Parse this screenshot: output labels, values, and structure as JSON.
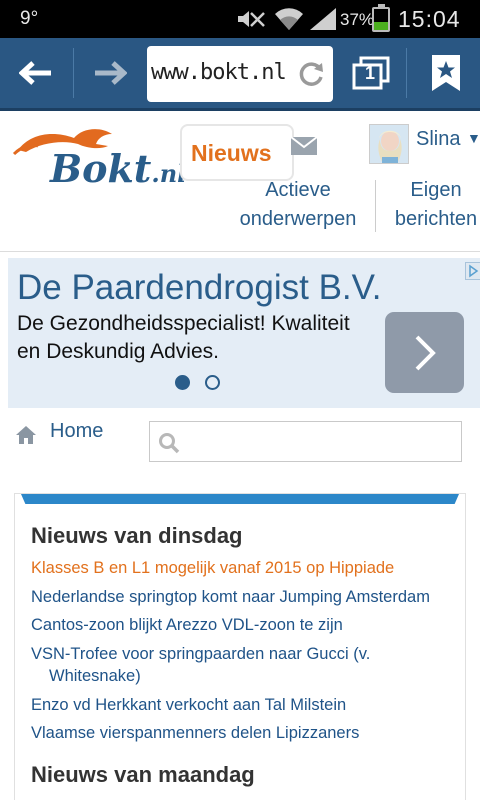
{
  "status_bar": {
    "temperature": "9°",
    "battery_percent": "37%",
    "time": "15:04"
  },
  "browser": {
    "url": "www.bokt.nl",
    "tab_count": "1"
  },
  "site": {
    "logo_text": "Bokt",
    "logo_suffix": ".nl",
    "news_label": "Nieuws",
    "user_name": "Slina",
    "active_topics": "Actieve onderwerpen",
    "own_posts": "Eigen berichten"
  },
  "ad": {
    "title": "De Paardendrogist B.V.",
    "description": "De Gezondheidsspecialist! Kwaliteit en Deskundig Advies."
  },
  "breadcrumb": {
    "home": "Home"
  },
  "search": {
    "value": ""
  },
  "news": {
    "sections": [
      {
        "title": "Nieuws van dinsdag",
        "items": [
          "Klasses B en L1 mogelijk vanaf 2015 op Hippiade",
          "Nederlandse springtop komt naar Jumping Amsterdam",
          "Cantos-zoon blijkt Arezzo VDL-zoon te zijn",
          "VSN-Trofee voor springpaarden naar Gucci (v.",
          "Whitesnake)",
          "Enzo vd Herkkant verkocht aan Tal Milstein",
          "Vlaamse vierspanmenners delen Lipizzaners"
        ]
      },
      {
        "title": "Nieuws van maandag"
      }
    ]
  },
  "colors": {
    "brand_blue": "#2a5d8a",
    "accent_orange": "#e2711d",
    "toolbar_blue": "#2a5783"
  }
}
